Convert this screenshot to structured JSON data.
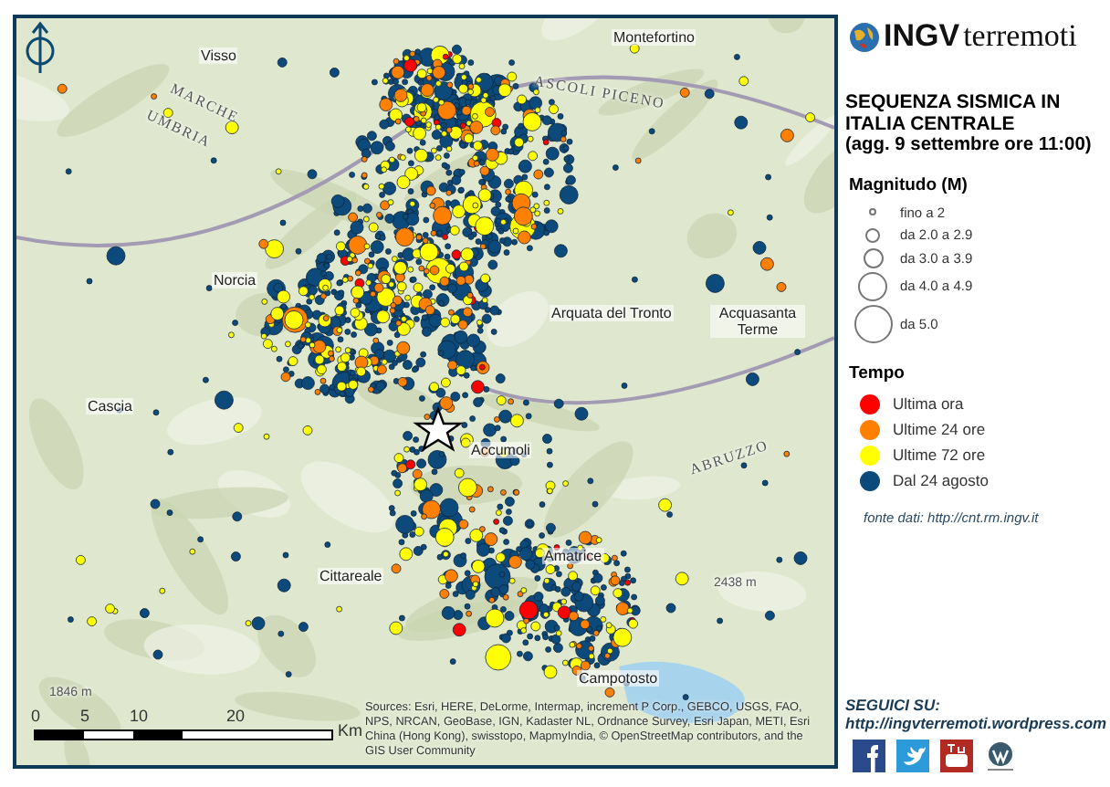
{
  "map": {
    "places": [
      {
        "name": "Montefortino",
        "kind": "town"
      },
      {
        "name": "Visso",
        "kind": "town"
      },
      {
        "name": "MARCHE",
        "kind": "region"
      },
      {
        "name": "UMBRIA",
        "kind": "region"
      },
      {
        "name": "ASCOLI PICENO",
        "kind": "region"
      },
      {
        "name": "Norcia",
        "kind": "town"
      },
      {
        "name": "Arquata del Tronto",
        "kind": "town"
      },
      {
        "name": "Acquasanta Terme",
        "kind": "town"
      },
      {
        "name": "Cascia",
        "kind": "town"
      },
      {
        "name": "Accumoli",
        "kind": "town"
      },
      {
        "name": "ABRUZZO",
        "kind": "region"
      },
      {
        "name": "Amatrice",
        "kind": "town"
      },
      {
        "name": "Cittareale",
        "kind": "town"
      },
      {
        "name": "2438 m",
        "kind": "peak"
      },
      {
        "name": "Campotosto",
        "kind": "town"
      },
      {
        "name": "1846 m",
        "kind": "peak"
      }
    ],
    "scale": {
      "ticks": [
        "0",
        "5",
        "10",
        "20"
      ],
      "unit": "Km"
    },
    "attribution": "Sources: Esri, HERE, DeLorme, Intermap, increment P Corp., GEBCO, USGS, FAO, NPS, NRCAN, GeoBase, IGN, Kadaster NL, Ordnance Survey, Esri Japan, METI, Esri China (Hong Kong), swisstopo, MapmyIndia, © OpenStreetMap contributors, and the GIS User Community"
  },
  "logo": {
    "brand": "INGV",
    "product": "terremoti"
  },
  "title": "SEQUENZA SISMICA IN ITALIA CENTRALE",
  "subtitle": "(agg. 9 settembre ore 11:00)",
  "magnitude_legend": {
    "title": "Magnitudo (M)",
    "items": [
      {
        "label": "fino a 2"
      },
      {
        "label": "da 2.0 a 2.9"
      },
      {
        "label": "da 3.0 a 3.9"
      },
      {
        "label": "da 4.0 a 4.9"
      },
      {
        "label": "da 5.0"
      }
    ]
  },
  "time_legend": {
    "title": "Tempo",
    "items": [
      {
        "label": "Ultima ora",
        "color": "#ff0000"
      },
      {
        "label": "Ultime 24 ore",
        "color": "#ff8000"
      },
      {
        "label": "Ultime 72 ore",
        "color": "#ffff00"
      },
      {
        "label": "Dal 24 agosto",
        "color": "#0b4a7a"
      }
    ]
  },
  "source": {
    "label": "fonte dati:",
    "url": "http://cnt.rm.ingv.it"
  },
  "follow": {
    "label": "SEGUICI SU:",
    "url": "http://ingvterremoti.wordpress.com"
  }
}
